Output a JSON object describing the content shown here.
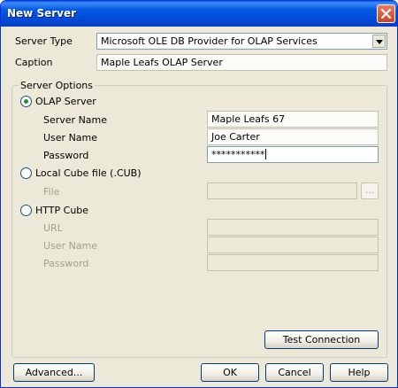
{
  "window": {
    "title": "New Server"
  },
  "server_type": {
    "label": "Server Type",
    "value": "Microsoft OLE DB Provider for OLAP Services"
  },
  "caption": {
    "label": "Caption",
    "value": "Maple Leafs OLAP Server"
  },
  "server_options": {
    "legend": "Server Options",
    "olap_server": {
      "label": "OLAP Server",
      "selected": true,
      "server_name": {
        "label": "Server Name",
        "value": "Maple Leafs 67"
      },
      "user_name": {
        "label": "User Name",
        "value": "Joe Carter"
      },
      "password": {
        "label": "Password",
        "value": "***********"
      }
    },
    "local_cube": {
      "label": "Local Cube file (.CUB)",
      "file": {
        "label": "File",
        "value": ""
      },
      "browse_label": "..."
    },
    "http_cube": {
      "label": "HTTP Cube",
      "url": {
        "label": "URL",
        "value": ""
      },
      "user_name": {
        "label": "User Name",
        "value": ""
      },
      "password": {
        "label": "Password",
        "value": ""
      }
    },
    "test_connection_label": "Test Connection"
  },
  "buttons": {
    "advanced": "Advanced...",
    "ok": "OK",
    "cancel": "Cancel",
    "help": "Help"
  },
  "icons": {
    "close": "close-icon",
    "dropdown": "chevron-down-icon"
  },
  "colors": {
    "titlebar": "#0559e1",
    "close": "#d75a3a",
    "dialog_bg": "#ece9d8"
  }
}
